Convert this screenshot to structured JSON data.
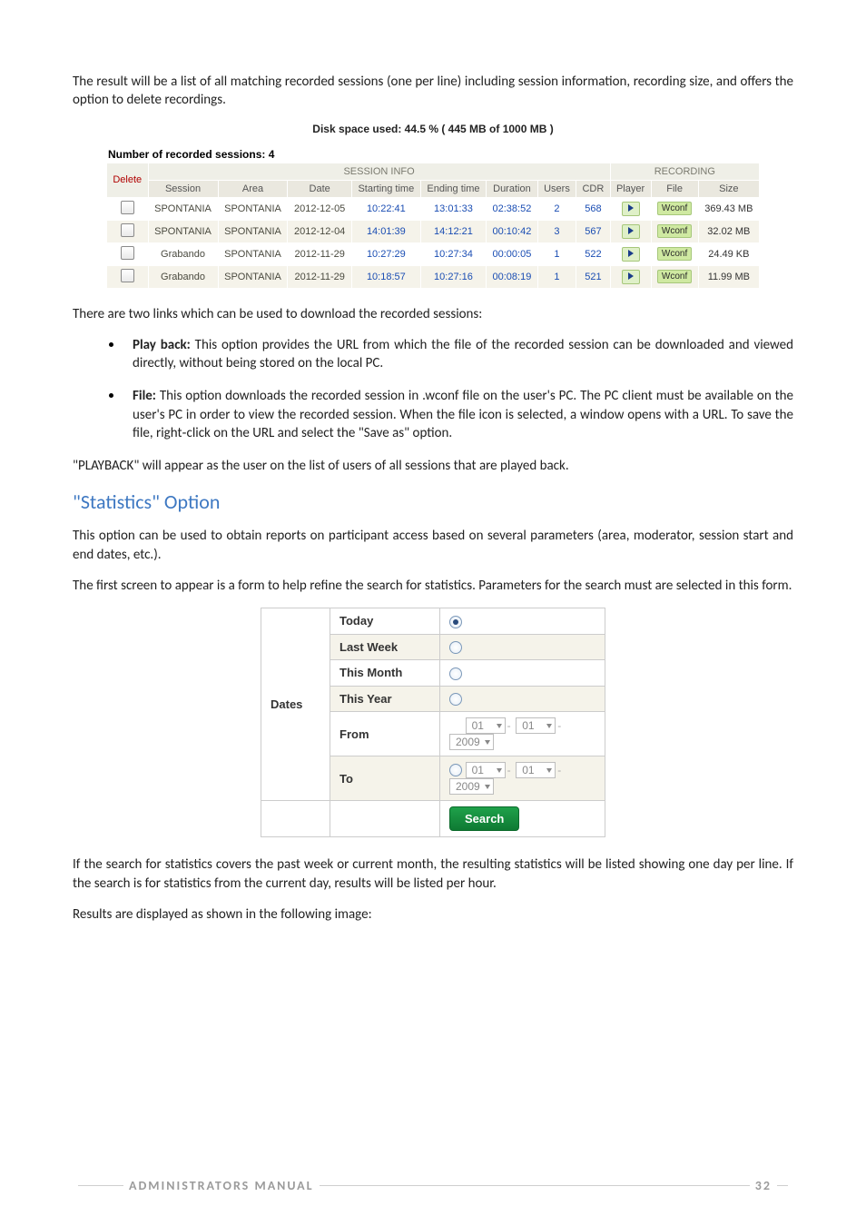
{
  "para_intro": "The result will be a list of all matching recorded sessions (one per line) including session information, recording size, and offers the option to delete recordings.",
  "disk_caption": "Disk space used: 44.5 % ( 445 MB of 1000 MB )",
  "sessions": {
    "count_label": "Number of recorded sessions: 4",
    "hdr_delete": "Delete",
    "hdr_session_info": "SESSION INFO",
    "hdr_recording": "RECORDING",
    "cols": {
      "session": "Session",
      "area": "Area",
      "date": "Date",
      "start": "Starting time",
      "end": "Ending time",
      "duration": "Duration",
      "users": "Users",
      "cdr": "CDR",
      "player": "Player",
      "file": "File",
      "size": "Size"
    },
    "rows": [
      {
        "session": "SPONTANIA",
        "area": "SPONTANIA",
        "date": "2012-12-05",
        "start": "10:22:41",
        "end": "13:01:33",
        "dur": "02:38:52",
        "users": "2",
        "cdr": "568",
        "file": "Wconf",
        "size": "369.43 MB"
      },
      {
        "session": "SPONTANIA",
        "area": "SPONTANIA",
        "date": "2012-12-04",
        "start": "14:01:39",
        "end": "14:12:21",
        "dur": "00:10:42",
        "users": "3",
        "cdr": "567",
        "file": "Wconf",
        "size": "32.02 MB"
      },
      {
        "session": "Grabando",
        "area": "SPONTANIA",
        "date": "2012-11-29",
        "start": "10:27:29",
        "end": "10:27:34",
        "dur": "00:00:05",
        "users": "1",
        "cdr": "522",
        "file": "Wconf",
        "size": "24.49 KB"
      },
      {
        "session": "Grabando",
        "area": "SPONTANIA",
        "date": "2012-11-29",
        "start": "10:18:57",
        "end": "10:27:16",
        "dur": "00:08:19",
        "users": "1",
        "cdr": "521",
        "file": "Wconf",
        "size": "11.99 MB"
      }
    ]
  },
  "para_links": "There are two links which can be used to download the recorded sessions:",
  "bullets": {
    "playback": {
      "label": "Play back:",
      "text": " This option provides the URL from which the file of the recorded session can be downloaded and viewed directly, without being stored on the local PC."
    },
    "file": {
      "label": "File:",
      "text": " This option downloads the recorded session in .wconf file on the user's PC. The PC client must be available on the user's PC in order to view the recorded session. When the file icon is selected, a window opens with a URL. To save the file, right‑click on the URL and select the \"Save as\" option."
    }
  },
  "para_playback": "\"PLAYBACK\" will appear as the user on the list of users of all sessions that are played back.",
  "h2_stats": "\"Statistics\" Option",
  "para_stats1": "This option can be used to obtain reports on participant access based on several parameters (area, moderator, session start and end dates, etc.).",
  "para_stats2": "The first screen to appear is a form to help refine the search for statistics. Parameters for the search must are selected in this form.",
  "dates": {
    "group_label": "Dates",
    "rows": {
      "today": "Today",
      "last_week": "Last Week",
      "this_month": "This Month",
      "this_year": "This Year",
      "from": "From",
      "to": "To"
    },
    "d": "01",
    "m": "01",
    "y": "2009",
    "search": "Search"
  },
  "para_stats3": "If the search for statistics covers the past week or current month, the resulting statistics will be listed showing one day per line. If the search is for statistics from the current day, results will be listed per hour.",
  "para_stats4": "Results are displayed as shown in the following image:",
  "footer": {
    "title": "ADMINISTRATORS MANUAL",
    "page": "32"
  }
}
